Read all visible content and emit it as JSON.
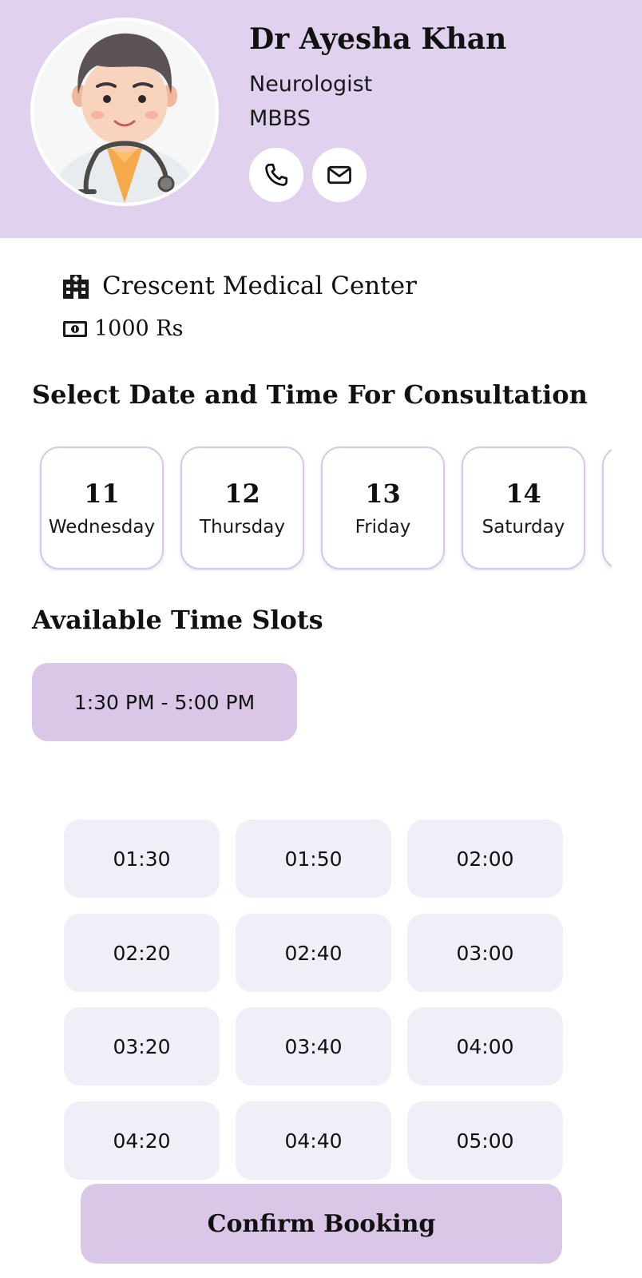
{
  "doctor": {
    "name": "Dr Ayesha Khan",
    "specialty": "Neurologist",
    "degree": "MBBS",
    "contact_icons": [
      "phone-icon",
      "mail-icon"
    ]
  },
  "info": {
    "hospital": "Crescent Medical Center",
    "hospital_icon": "hospital-icon",
    "fee": "1000 Rs",
    "fee_icon": "money-icon"
  },
  "date_section": {
    "title": "Select Date and Time For Consultation",
    "dates": [
      {
        "day_num": "11",
        "day_name": "Wednesday"
      },
      {
        "day_num": "12",
        "day_name": "Thursday"
      },
      {
        "day_num": "13",
        "day_name": "Friday"
      },
      {
        "day_num": "14",
        "day_name": "Saturday"
      }
    ]
  },
  "slots_section": {
    "title": "Available Time Slots",
    "range": "1:30 PM - 5:00 PM",
    "times": [
      "01:30",
      "01:50",
      "02:00",
      "02:20",
      "02:40",
      "03:00",
      "03:20",
      "03:40",
      "04:00",
      "04:20",
      "04:40",
      "05:00"
    ]
  },
  "confirm_label": "Confirm Booking",
  "colors": {
    "header_bg": "#e0d2ee",
    "accent": "#dac7e8",
    "slot_bg": "#f2eef7",
    "card_border": "#d7c8e6"
  }
}
